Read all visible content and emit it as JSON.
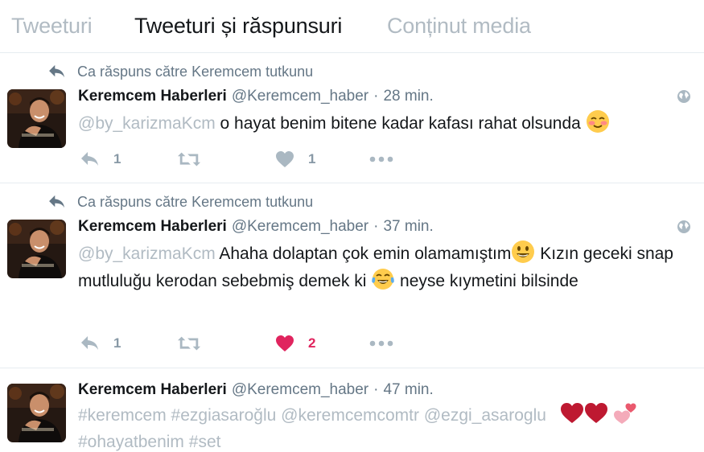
{
  "tabs": [
    {
      "label": "Tweeturi",
      "active": false
    },
    {
      "label": "Tweeturi și răspunsuri",
      "active": true
    },
    {
      "label": "Conținut media",
      "active": false
    }
  ],
  "colors": {
    "accent_text": "#14171a",
    "muted": "#657786",
    "link_muted": "#b1bbc3",
    "like_red": "#e0245e",
    "action_gray": "#aab8c2"
  },
  "tweets": [
    {
      "context": "Ca răspuns către Keremcem tutkunu",
      "name": "Keremcem Haberleri",
      "handle": "@Keremcem_haber",
      "separator": "·",
      "time": "28 min.",
      "mention": "@by_karizmaKcm",
      "text_1": " o hayat benim bitene kadar kafası rahat olsunda ",
      "emoji_1": "smiling-blush-emoji",
      "reply_count": "1",
      "retweet_count": "",
      "like_count": "1",
      "liked": false
    },
    {
      "context": "Ca răspuns către Keremcem tutkunu",
      "name": "Keremcem Haberleri",
      "handle": "@Keremcem_haber",
      "separator": "·",
      "time": "37 min.",
      "mention": "@by_karizmaKcm",
      "text_1": " Ahaha dolaptan çok emin olamamıştım",
      "emoji_1": "grinning-emoji",
      "text_2": " Kızın geceki snap  mutluluğu kerodan sebebmiş demek ki ",
      "emoji_2": "tears-of-joy-emoji",
      "text_3": " neyse kıymetini bilsinde",
      "reply_count": "1",
      "retweet_count": "",
      "like_count": "2",
      "liked": true
    },
    {
      "name": "Keremcem Haberleri",
      "handle": "@Keremcem_haber",
      "separator": "·",
      "time": "47 min.",
      "hashtag_1": "#keremcem",
      "hashtag_2": "#ezgiasaroğlu",
      "mention_1": "@keremcemcomtr",
      "mention_2": "@ezgi_asaroglu",
      "emoji_1": "red-heart-emoji",
      "emoji_2": "two-hearts-emoji",
      "hashtag_3": "#ohayatbenim",
      "hashtag_4": "#set"
    }
  ]
}
